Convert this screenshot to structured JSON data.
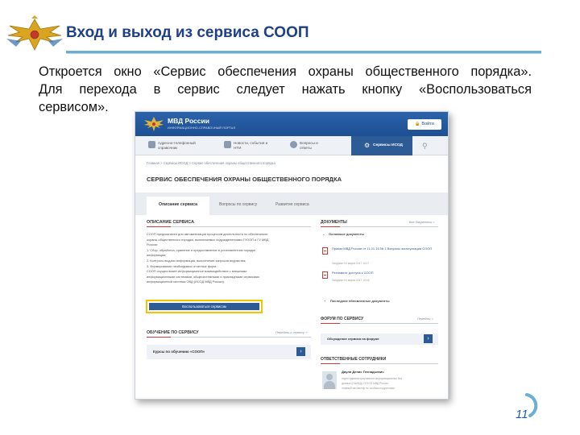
{
  "slide": {
    "title": "Вход и выход из сервиса СООП",
    "body_line1": "Откроется окно «Сервис обеспечения охраны общественного порядка».",
    "body_line2": "Для перехода в сервис следует нажать кнопку «Воспользоваться",
    "body_line3": "сервисом».",
    "page_number": "11",
    "colors": {
      "title": "#1f3f86",
      "rule": "#6aaed6",
      "highlight": "#f2c400"
    }
  },
  "screenshot": {
    "header": {
      "brand": "МВД России",
      "brand_sub": "ИНФОРМАЦИОННО-СПРАВОЧНЫЙ ПОРТАЛ",
      "login_label": "Войти",
      "login_icon": "lock-icon"
    },
    "nav": {
      "items": [
        {
          "label": "Адресно-телефонный справочник",
          "icon": "phonebook-icon"
        },
        {
          "label": "Новости, события и НТИ",
          "icon": "news-icon"
        },
        {
          "label": "Вопросы и ответы",
          "icon": "qa-icon"
        }
      ],
      "active": {
        "label": "Сервисы ИСОД",
        "icon": "gear-icon"
      },
      "search_icon": "search-icon"
    },
    "breadcrumb": "Главная  >  Сервисы ИСОД  >  Сервис обеспечения охраны общественного порядка",
    "page_title": "СЕРВИС ОБЕСПЕЧЕНИЯ ОХРАНЫ ОБЩЕСТВЕННОГО ПОРЯДКА",
    "tabs": [
      {
        "label": "Описание сервиса",
        "active": true
      },
      {
        "label": "Вопросы по сервису",
        "active": false
      },
      {
        "label": "Развитие сервиса",
        "active": false
      }
    ],
    "description": {
      "heading": "ОПИСАНИЕ СЕРВИСА",
      "lines": [
        "СООП предназначен для автоматизации процессов деятельности по обеспечению",
        "охраны общественного порядка, выполняемых подразделениями ГУООП и ГУ МВД",
        "России:",
        "1. Сбор, обработка, хранение и предоставление в установленном порядке",
        "информации;",
        "2. Контроль выдачи информации, выполнение запросов ведомства;",
        "3. Формирование необходимых отчетных форм.",
        "СООП осуществляет информационное взаимодействие с внешними",
        "информационными системами, общесистемными и прикладными сервисами",
        "информационной системы ОВД (ИСОД МВД России)."
      ],
      "use_button": "Воспользоваться сервисом"
    },
    "learning": {
      "heading": "ОБУЧЕНИЕ ПО СЕРВИСУ",
      "link": "Перейти к сервису >",
      "course": "Курсы по обучению «СООП»"
    },
    "documents": {
      "heading": "ДОКУМЕНТЫ",
      "link": "Все документы >",
      "group_main": "Основные документы",
      "doc1_title": "Приказ МВД России от 11.01.16 № 1 Вопросы эксплуатации СООП",
      "doc1_meta": "Загружен 04 марта 2017 10:17",
      "doc2_title": "Регламент доступа к СООП",
      "doc2_meta": "Загружен 04 марта 2017 10:18",
      "group_recent": "Последние обновленные документы"
    },
    "forum": {
      "heading": "ФОРУМ ПО СЕРВИСУ",
      "link": "Перейти >",
      "item": "Обсуждение сервиса на форуме"
    },
    "staff": {
      "heading": "ОТВЕТСТВЕННЫЕ СОТРУДНИКИ",
      "name": "Двуля Денис Геннадьевич",
      "role1": "отдел администрирования информационных баз",
      "role2": "данных (ОАИБД) ГУООП МВД России",
      "role3": "главный инспектор по особым поручениям"
    }
  }
}
